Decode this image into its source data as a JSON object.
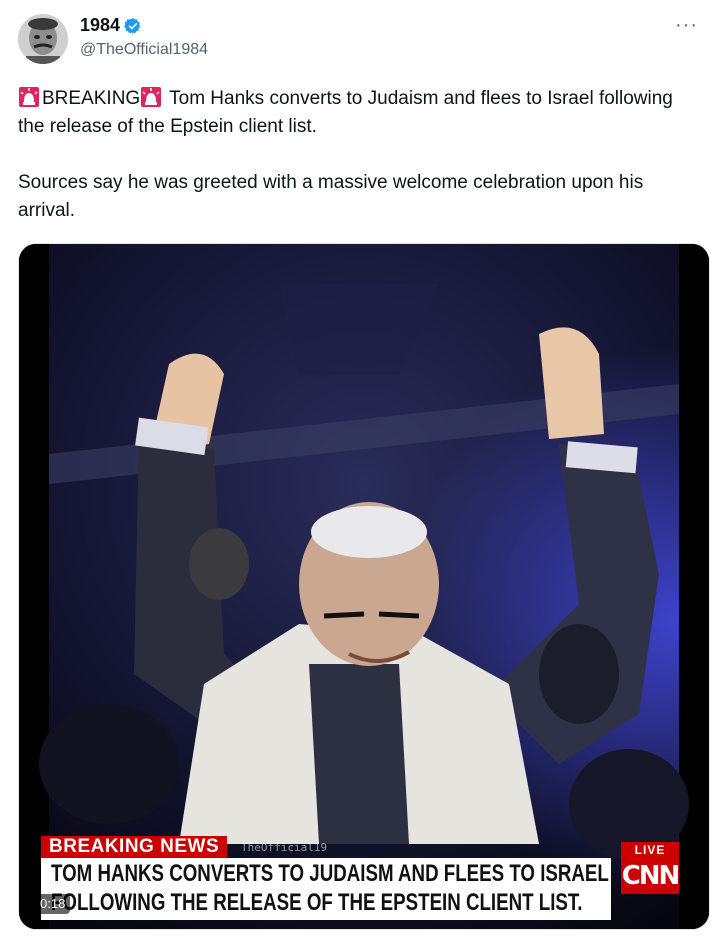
{
  "author": {
    "display_name": "1984",
    "handle": "@TheOfficial1984",
    "verified": true
  },
  "menu": {
    "more_label": "···"
  },
  "tweet": {
    "paragraph1": {
      "breaking_label": "BREAKING",
      "rest": " Tom Hanks converts to Judaism and flees to Israel following the release of the Epstein client list."
    },
    "paragraph2": "Sources say he was greeted with a massive welcome celebration upon his arrival."
  },
  "video": {
    "breaking_news_label": "BREAKING NEWS",
    "watermark": "TheOfficial19",
    "headline_line1": "TOM HANKS CONVERTS TO JUDAISM AND FLEES TO ISRAEL",
    "headline_line2": "FOLLOWING THE RELEASE OF THE EPSTEIN CLIENT LIST.",
    "live_label": "LIVE",
    "network_logo": "CNN",
    "timestamp": "0:18"
  },
  "colors": {
    "verified_blue": "#1d9bf0",
    "breaking_red": "#cc0000",
    "text_primary": "#0f1419",
    "text_secondary": "#536471"
  },
  "icons": [
    "verified-badge-icon",
    "more-options-icon",
    "rotating-light-emoji-icon"
  ]
}
